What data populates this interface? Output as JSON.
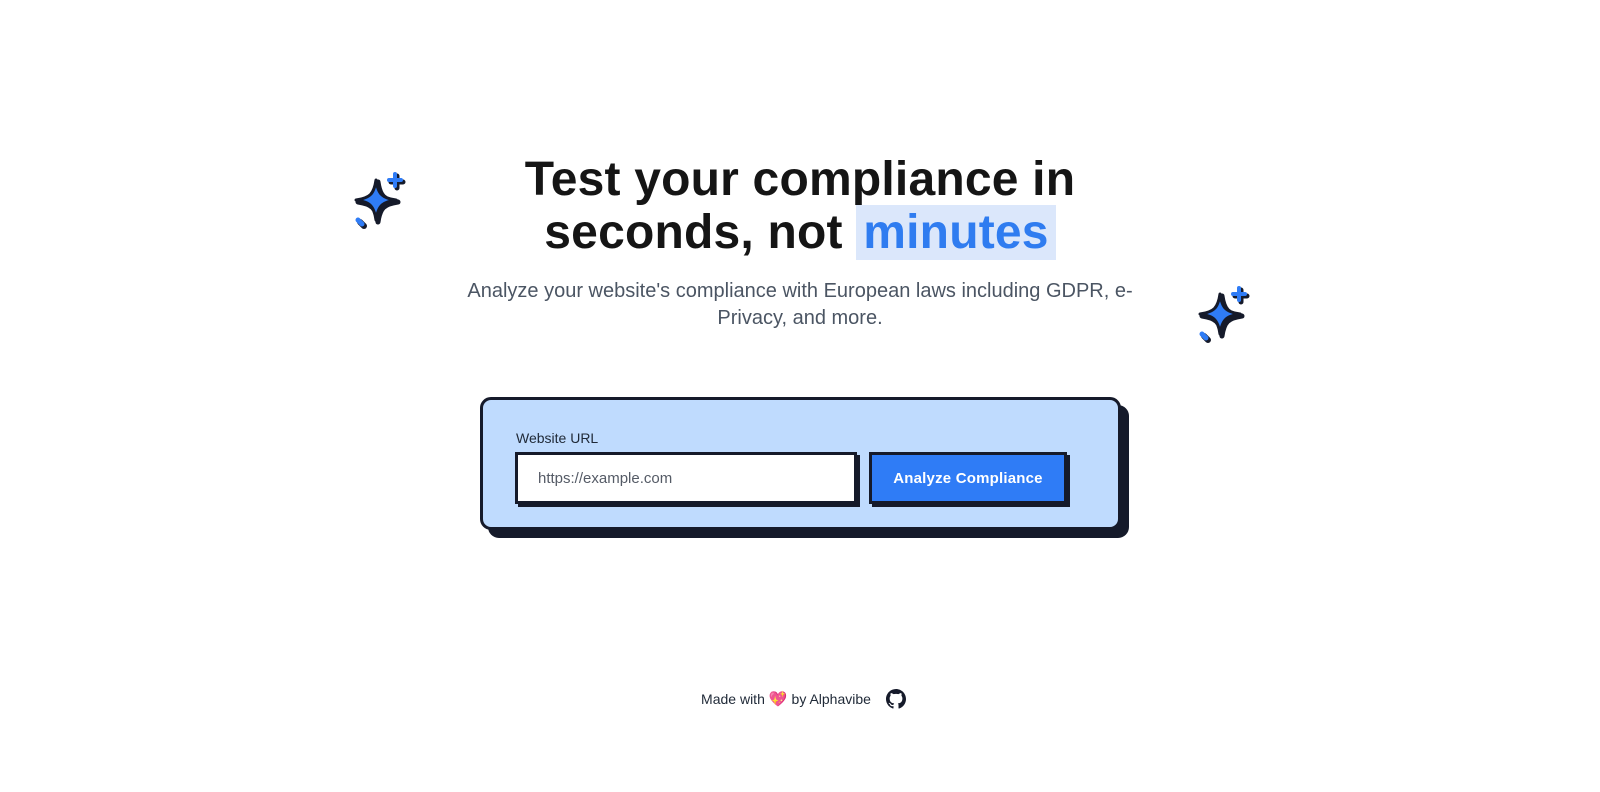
{
  "hero": {
    "title_line1": "Test your compliance in",
    "title_line2_prefix": "seconds, not ",
    "title_highlight": "minutes",
    "subtitle": "Analyze your website's compliance with European laws including GDPR, e-Privacy, and more."
  },
  "form": {
    "url_label": "Website URL",
    "url_placeholder": "https://example.com",
    "url_value": "",
    "submit_label": "Analyze Compliance"
  },
  "footer": {
    "made_with": "Made with",
    "heart": "💖",
    "by_text": "by Alphavibe",
    "github_icon": "github-icon"
  },
  "colors": {
    "accent": "#2f7cf6",
    "card_bg": "#bfdbfe",
    "highlight_bg": "#dbe7fb",
    "dark": "#151a2a"
  }
}
